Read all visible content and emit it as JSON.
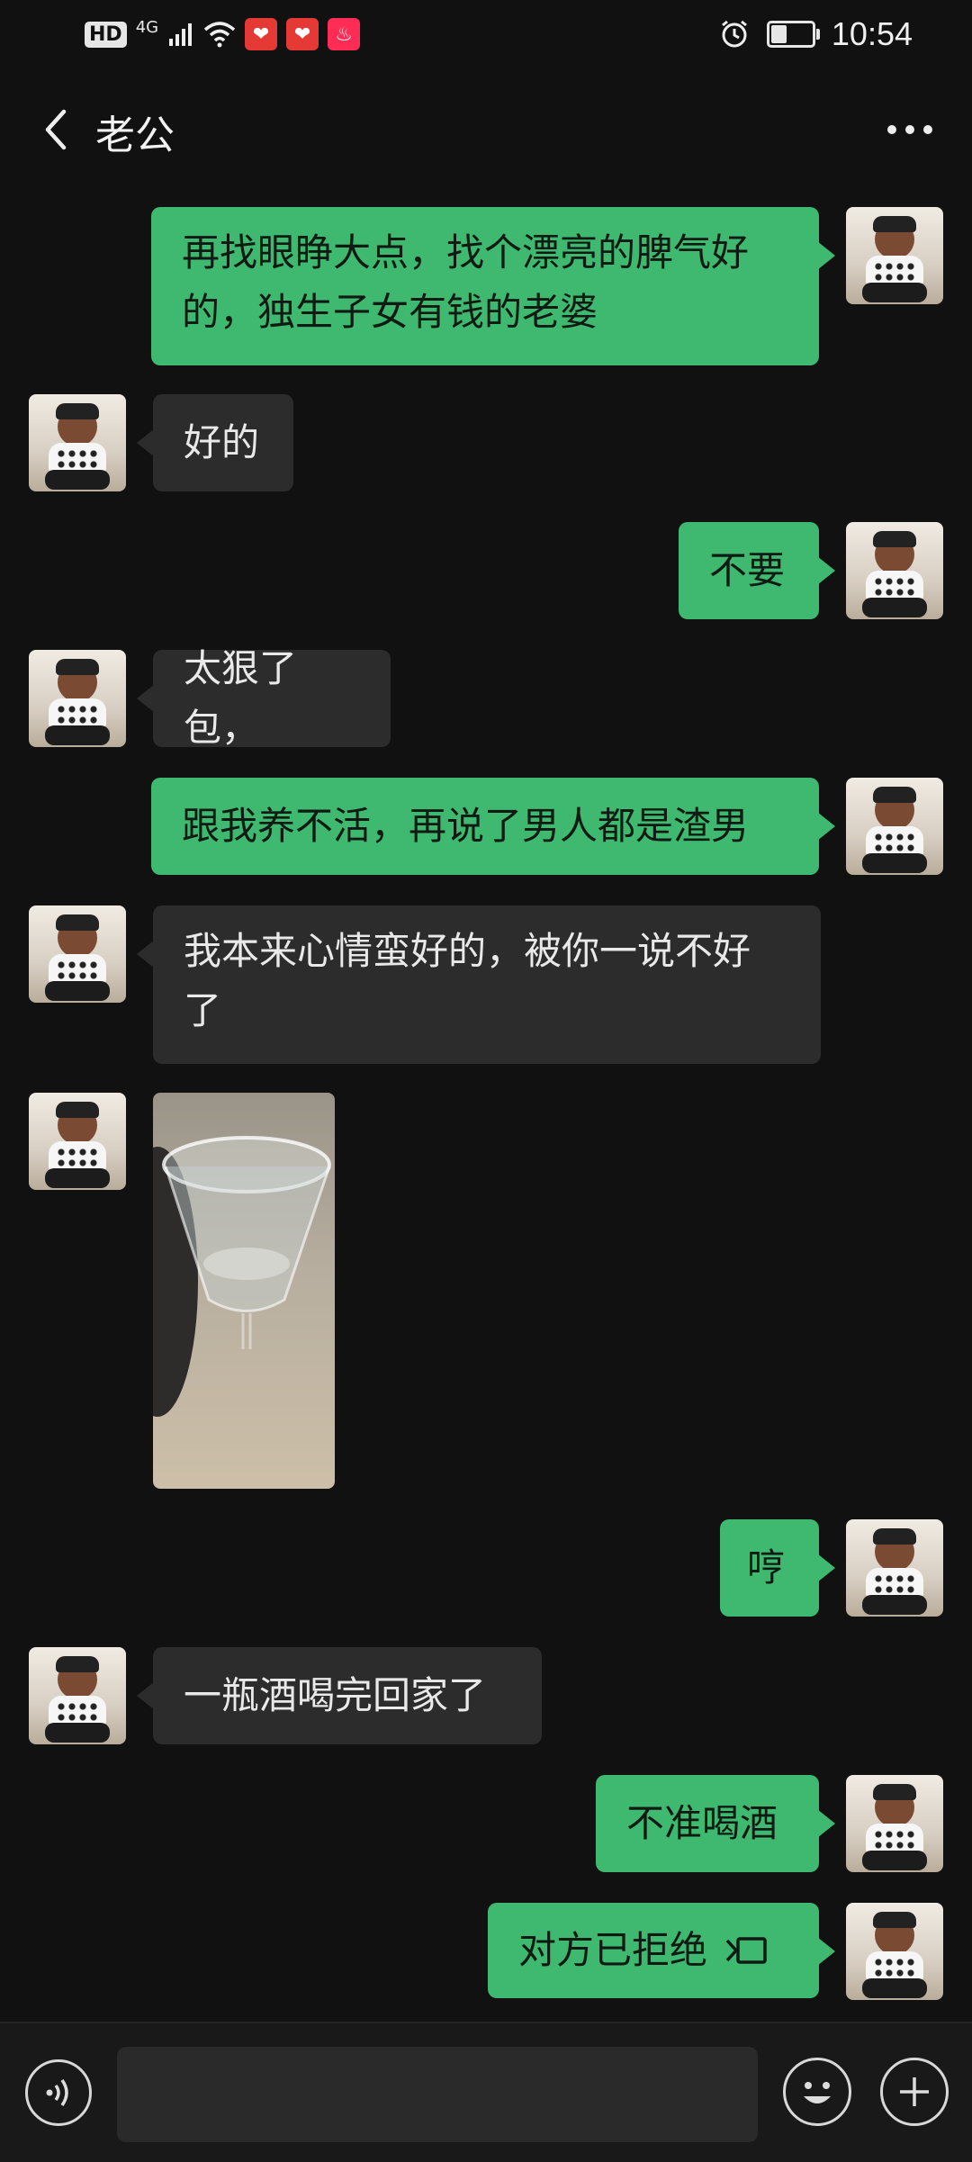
{
  "status_bar": {
    "hd": "HD",
    "network": "4G",
    "time": "10:54",
    "battery_level": 0.35
  },
  "header": {
    "title": "老公"
  },
  "messages": [
    {
      "dir": "out",
      "lines": [
        "再找眼睁大点，找个漂亮的脾气好",
        "的，独生子女有钱的老婆"
      ]
    },
    {
      "dir": "in",
      "text": "好的"
    },
    {
      "dir": "out",
      "text": "不要"
    },
    {
      "dir": "in",
      "text": "太狠了包，"
    },
    {
      "dir": "out",
      "text": "跟我养不活，再说了男人都是渣男"
    },
    {
      "dir": "in",
      "lines": [
        "我本来心情蛮好的，被你一说不好",
        "了"
      ]
    },
    {
      "dir": "in",
      "type": "image"
    },
    {
      "dir": "out",
      "text": "哼"
    },
    {
      "dir": "in",
      "text": "一瓶酒喝完回家了"
    },
    {
      "dir": "out",
      "text": "不准喝酒"
    },
    {
      "dir": "out",
      "type": "call",
      "text": "对方已拒绝"
    }
  ],
  "colors": {
    "background": "#111111",
    "out_bubble": "#3fb870",
    "in_bubble": "#2c2c2c"
  }
}
